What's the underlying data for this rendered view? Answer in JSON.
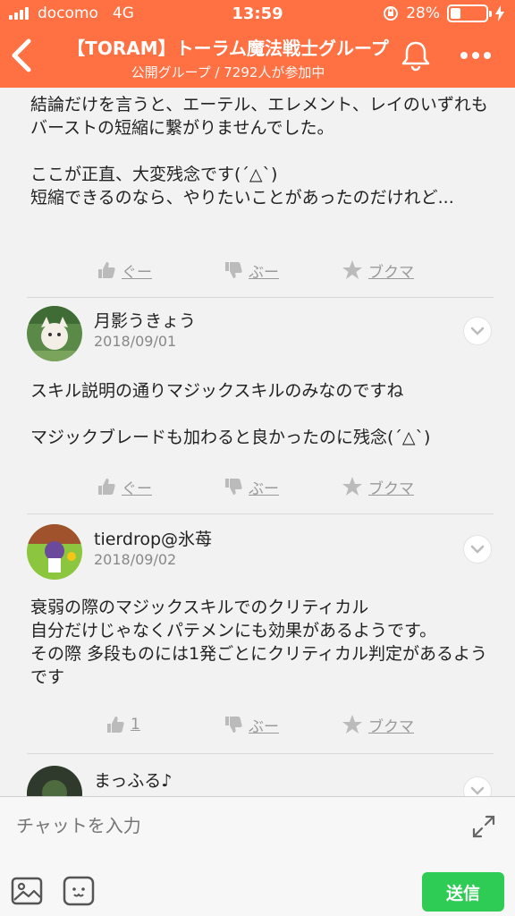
{
  "status_bar": {
    "carrier": "docomo",
    "network": "4G",
    "time": "13:59",
    "battery": "28%",
    "battery_level": 0.28
  },
  "header": {
    "title": "【TORAM】トーラム魔法戦士グループ",
    "subtitle": "公開グループ / 7292人が参加中"
  },
  "posts": [
    {
      "body": "結論だけを言うと、エーテル、エレメント、レイのいずれもバーストの短縮に繋がりませんでした。\n\nここが正直、大変残念です(´△`)\n短縮できるのなら、やりたいことがあったのだけれど...",
      "like_label": "ぐー",
      "dislike_label": "ぶー",
      "bookmark_label": "ブクマ"
    },
    {
      "author": "月影うきょう",
      "date": "2018/09/01",
      "body": "スキル説明の通りマジックスキルのみなのですね\n\nマジックブレードも加わると良かったのに残念(´△`)",
      "like_label": "ぐー",
      "dislike_label": "ぶー",
      "bookmark_label": "ブクマ"
    },
    {
      "author": "tierdrop@氷苺",
      "date": "2018/09/02",
      "body": "衰弱の際のマジックスキルでのクリティカル\n自分だけじゃなくパテメンにも効果があるようです。\nその際 多段ものには1発ごとにクリティカル判定があるようです",
      "like_label": "1",
      "dislike_label": "ぶー",
      "bookmark_label": "ブクマ"
    },
    {
      "author": "まっふる♪"
    }
  ],
  "composer": {
    "placeholder": "チャットを入力",
    "send_label": "送信"
  },
  "colors": {
    "header": "#ff7043",
    "send": "#2ecc55"
  }
}
